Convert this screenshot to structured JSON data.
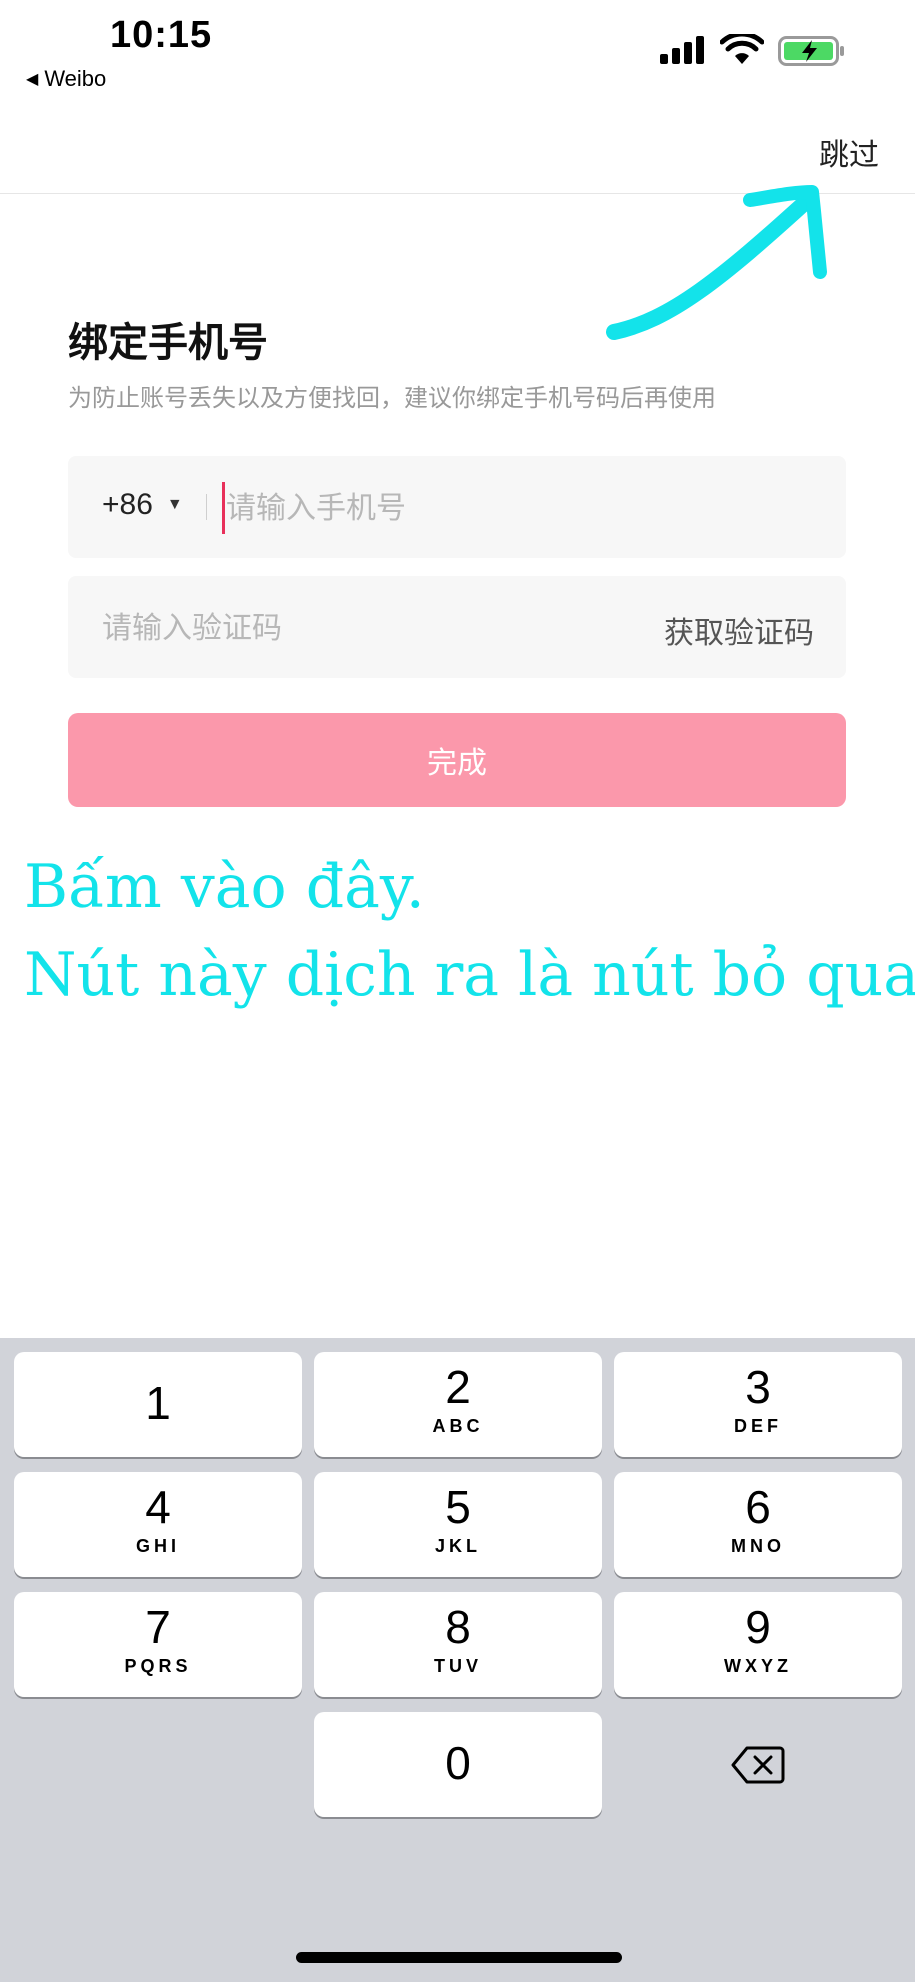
{
  "status_bar": {
    "time": "10:15",
    "back_app": "Weibo",
    "icons": [
      "cellular-signal-icon",
      "wifi-icon",
      "battery-charging-icon"
    ]
  },
  "nav": {
    "skip_label": "跳过"
  },
  "content": {
    "title": "绑定手机号",
    "subtitle": "为防止账号丢失以及方便找回，建议你绑定手机号码后再使用",
    "country_code": "+86",
    "phone_placeholder": "请输入手机号",
    "code_placeholder": "请输入验证码",
    "get_code_label": "获取验证码",
    "done_label": "完成"
  },
  "annotation": {
    "line1": "Bấm vào đây.",
    "line2": "Nút này dịch ra là nút bỏ qua",
    "color": "#13e3ea"
  },
  "keypad": {
    "keys": [
      {
        "digit": "1",
        "letters": ""
      },
      {
        "digit": "2",
        "letters": "ABC"
      },
      {
        "digit": "3",
        "letters": "DEF"
      },
      {
        "digit": "4",
        "letters": "GHI"
      },
      {
        "digit": "5",
        "letters": "JKL"
      },
      {
        "digit": "6",
        "letters": "MNO"
      },
      {
        "digit": "7",
        "letters": "PQRS"
      },
      {
        "digit": "8",
        "letters": "TUV"
      },
      {
        "digit": "9",
        "letters": "WXYZ"
      },
      {
        "digit": "0",
        "letters": ""
      }
    ]
  },
  "colors": {
    "accent_button": "#fb98ab",
    "cursor": "#e8305a",
    "battery_fill": "#4cd964",
    "keypad_bg": "#d1d3d9"
  }
}
